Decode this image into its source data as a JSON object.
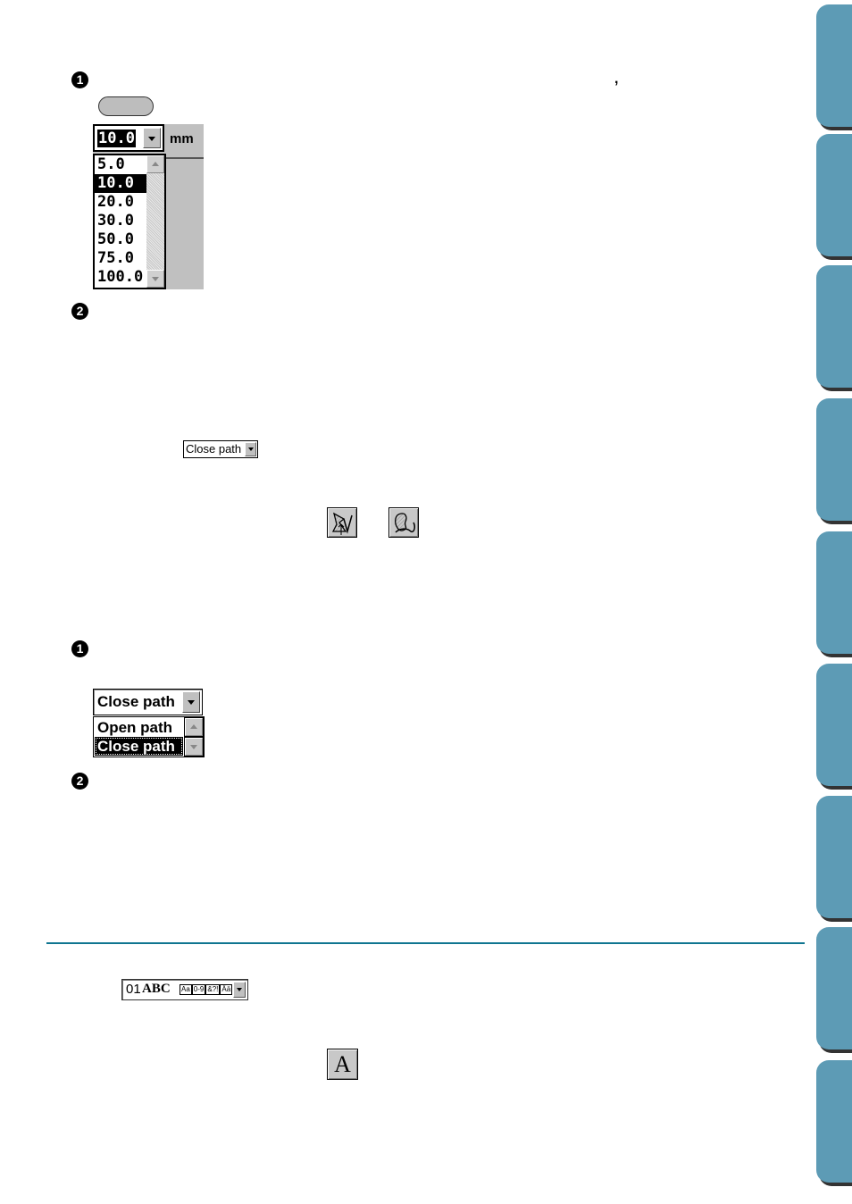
{
  "section1": {
    "step1_marker": "❶",
    "step1_comma": ",",
    "grid_size_combo": {
      "selected": "10.0",
      "unit": "mm",
      "options": [
        "5.0",
        "10.0",
        "20.0",
        "30.0",
        "50.0",
        "75.0",
        "100.0"
      ],
      "highlighted_option": "10.0"
    },
    "step2_marker": "❷"
  },
  "section2": {
    "inline_combo_value": "Close path",
    "tool_icons": [
      "outline-tool-icon",
      "curve-tool-icon"
    ],
    "step1_marker": "❶",
    "path_combo": {
      "selected": "Close path",
      "options": [
        "Open path",
        "Close path"
      ],
      "highlighted_option": "Close path"
    },
    "step2_marker": "❷"
  },
  "section3": {
    "font_combo": {
      "number": "01",
      "sample": "ABC",
      "char_sets": [
        "Aa",
        "0-9",
        "&?!",
        "Ää"
      ]
    },
    "text_tool_label": "A"
  },
  "side_tabs": {
    "count": 9,
    "color": "#5d9bb5"
  },
  "accent_color": "#0f7590"
}
